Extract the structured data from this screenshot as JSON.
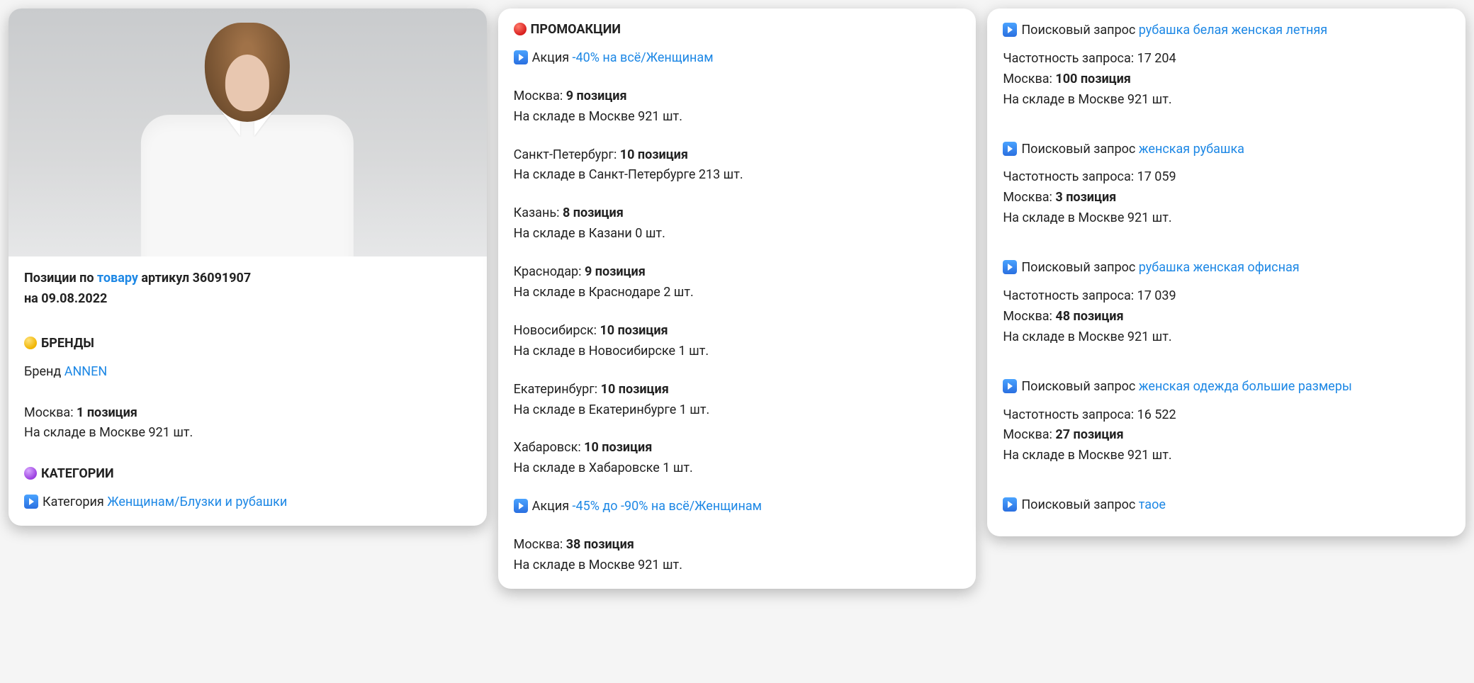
{
  "card1": {
    "positions_prefix": "Позиции по ",
    "product_link": "товару",
    "article_text": " артикул 36091907",
    "date_line": "на 09.08.2022",
    "brands_heading": "БРЕНДЫ",
    "brand_label": "Бренд ",
    "brand_link": "ANNEN",
    "brand_city_prefix": "Москва: ",
    "brand_city_value": "1 позиция",
    "brand_stock": "На складе в Москве 921  шт.",
    "categories_heading": "КАТЕГОРИИ",
    "category_label_prefix": "Категория ",
    "category_link": "Женщинам/Блузки и рубашки"
  },
  "card2": {
    "promo_heading": "ПРОМОАКЦИИ",
    "promo1_label": "Акция ",
    "promo1_link": "-40% на всё/Женщинам",
    "promo1_cities": [
      {
        "city_prefix": "Москва: ",
        "city_value": "9 позиция",
        "stock": "На складе в Москве 921  шт."
      },
      {
        "city_prefix": "Санкт-Петербург: ",
        "city_value": "10 позиция",
        "stock": "На складе в Санкт-Петербурге 213  шт."
      },
      {
        "city_prefix": "Казань: ",
        "city_value": "8 позиция",
        "stock": "На складе в Казани 0  шт."
      },
      {
        "city_prefix": "Краснодар: ",
        "city_value": "9 позиция",
        "stock": "На складе в Краснодаре 2  шт."
      },
      {
        "city_prefix": "Новосибирск: ",
        "city_value": "10 позиция",
        "stock": "На складе в Новосибирске 1  шт."
      },
      {
        "city_prefix": "Екатеринбург: ",
        "city_value": "10 позиция",
        "stock": "На складе в Екатеринбурге 1  шт."
      },
      {
        "city_prefix": "Хабаровск: ",
        "city_value": "10 позиция",
        "stock": "На складе в Хабаровске 1  шт."
      }
    ],
    "promo2_label": "Акция ",
    "promo2_link": "-45% до -90% на всё/Женщинам",
    "promo2_cities": [
      {
        "city_prefix": "Москва: ",
        "city_value": "38 позиция",
        "stock": "На складе в Москве 921  шт."
      }
    ]
  },
  "card3": {
    "query_label": "Поисковый запрос ",
    "queries": [
      {
        "link": "рубашка белая женская летняя",
        "freq": "Частотность запроса: 17 204",
        "city_prefix": "Москва: ",
        "city_value": "100 позиция",
        "stock": "На складе в Москве 921  шт."
      },
      {
        "link": "женская рубашка",
        "freq": "Частотность запроса: 17 059",
        "city_prefix": "Москва: ",
        "city_value": "3 позиция",
        "stock": "На складе в Москве 921  шт."
      },
      {
        "link": "рубашка женская офисная",
        "freq": "Частотность запроса: 17 039",
        "city_prefix": "Москва: ",
        "city_value": "48 позиция",
        "stock": "На складе в Москве 921  шт."
      },
      {
        "link": "женская одежда большие размеры",
        "freq": "Частотность запроса: 16 522",
        "city_prefix": "Москва: ",
        "city_value": "27 позиция",
        "stock": "На складе в Москве 921  шт."
      },
      {
        "link": "таое"
      }
    ]
  }
}
